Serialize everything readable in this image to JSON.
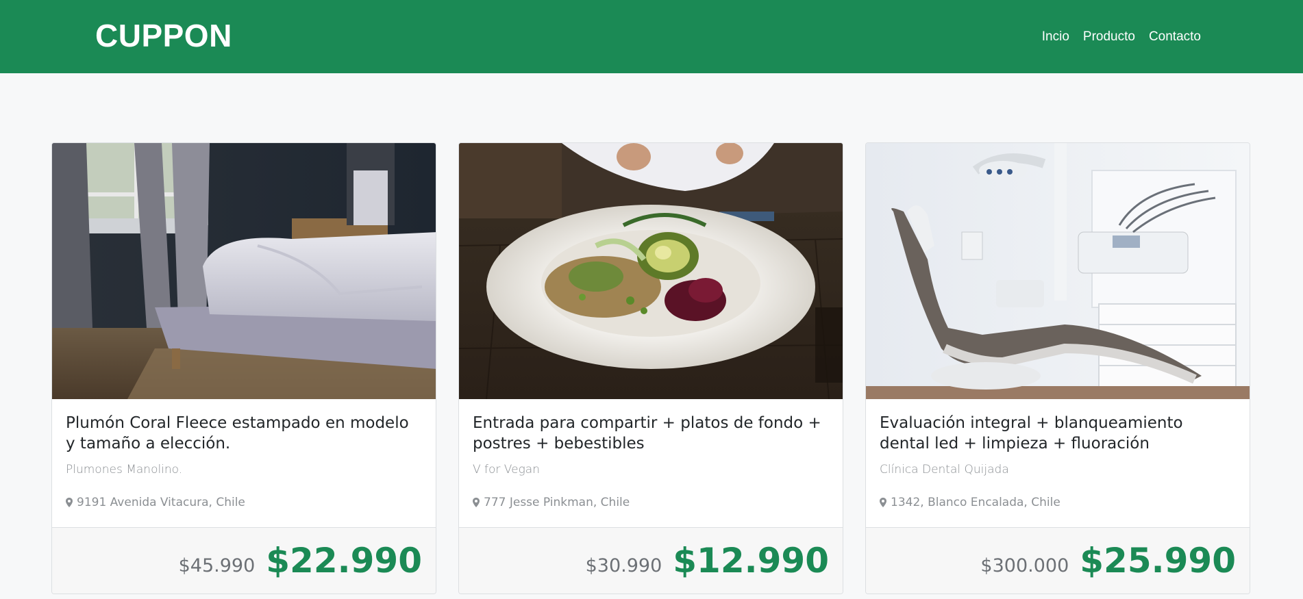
{
  "navbar": {
    "brand": "CUPPON",
    "links": [
      "Incio",
      "Producto",
      "Contacto"
    ]
  },
  "colors": {
    "brand_green": "#1b8a55",
    "background": "#f7f8f9"
  },
  "cards": [
    {
      "image": "bedroom-bed-photo",
      "title": "Plumón Coral Fleece estampado en modelo y tamaño a elección.",
      "merchant": "Plumones Manolino.",
      "address": "9191 Avenida Vitacura, Chile",
      "old_price": "$45.990",
      "new_price": "$22.990"
    },
    {
      "image": "vegan-salad-plate-photo",
      "title": "Entrada para compartir + platos de fondo + postres + bebestibles",
      "merchant": "V for Vegan",
      "address": "777 Jesse Pinkman, Chile",
      "old_price": "$30.990",
      "new_price": "$12.990"
    },
    {
      "image": "dental-chair-photo",
      "title": "Evaluación integral + blanqueamiento dental led + limpieza + fluoración",
      "merchant": "Clínica Dental Quijada",
      "address": "1342, Blanco Encalada, Chile",
      "old_price": "$300.000",
      "new_price": "$25.990"
    }
  ]
}
